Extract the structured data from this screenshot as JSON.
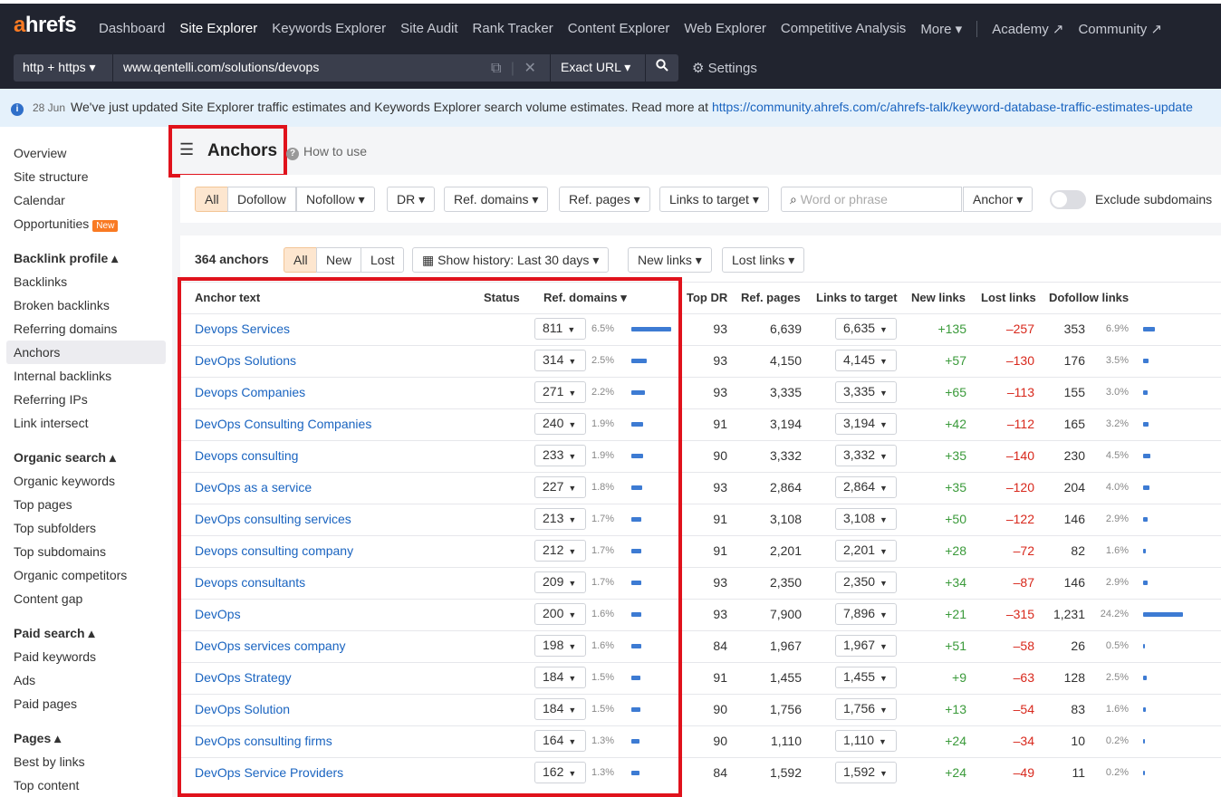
{
  "app": {
    "logo_a": "a",
    "logo_rest": "hrefs"
  },
  "nav": {
    "items": [
      "Dashboard",
      "Site Explorer",
      "Keywords Explorer",
      "Site Audit",
      "Rank Tracker",
      "Content Explorer",
      "Web Explorer",
      "Competitive Analysis",
      "More ▾"
    ],
    "active": "Site Explorer",
    "external": [
      "Academy ↗",
      "Community ↗"
    ]
  },
  "urlbar": {
    "protocol": "http + https ▾",
    "url": "www.qentelli.com/solutions/devops",
    "mode": "Exact URL ▾",
    "settings": "Settings"
  },
  "banner": {
    "date": "28 Jun",
    "text": "We've just updated Site Explorer traffic estimates and Keywords Explorer search volume estimates. Read more at ",
    "link": "https://community.ahrefs.com/c/ahrefs-talk/keyword-database-traffic-estimates-update"
  },
  "sidebar": {
    "overview": "Overview",
    "site_structure": "Site structure",
    "calendar": "Calendar",
    "opportunities": "Opportunities",
    "new_badge": "New",
    "backlink_profile": "Backlink profile ▴",
    "backlinks": "Backlinks",
    "broken_backlinks": "Broken backlinks",
    "referring_domains": "Referring domains",
    "anchors": "Anchors",
    "internal_backlinks": "Internal backlinks",
    "referring_ips": "Referring IPs",
    "link_intersect": "Link intersect",
    "organic_search": "Organic search ▴",
    "organic_keywords": "Organic keywords",
    "top_pages": "Top pages",
    "top_subfolders": "Top subfolders",
    "top_subdomains": "Top subdomains",
    "organic_competitors": "Organic competitors",
    "content_gap": "Content gap",
    "paid_search": "Paid search ▴",
    "paid_keywords": "Paid keywords",
    "ads": "Ads",
    "paid_pages": "Paid pages",
    "pages": "Pages ▴",
    "best_by_links": "Best by links",
    "top_content": "Top content"
  },
  "page": {
    "title": "Anchors",
    "how_to_use": "How to use"
  },
  "filters": {
    "all": "All",
    "dofollow": "Dofollow",
    "nofollow": "Nofollow ▾",
    "dr": "DR ▾",
    "ref_domains": "Ref. domains ▾",
    "ref_pages": "Ref. pages ▾",
    "links_to_target": "Links to target ▾",
    "search_placeholder": "Word or phrase",
    "anchor": "Anchor ▾",
    "exclude_subdomains": "Exclude subdomains"
  },
  "tablebar": {
    "count": "364 anchors",
    "all": "All",
    "new": "New",
    "lost": "Lost",
    "history": "Show history: Last 30 days ▾",
    "new_links": "New links ▾",
    "lost_links": "Lost links ▾"
  },
  "columns": {
    "anchor_text": "Anchor text",
    "status": "Status",
    "ref_domains": "Ref. domains ▾",
    "top_dr": "Top DR",
    "ref_pages": "Ref. pages",
    "links_to_target": "Links to target",
    "new_links": "New links",
    "lost_links": "Lost links",
    "dofollow_links": "Dofollow links"
  },
  "rows": [
    {
      "anchor": "Devops Services",
      "ref": "811",
      "ref_pct": "6.5%",
      "ref_frac": 1.0,
      "dr": "93",
      "pages": "6,639",
      "ltt": "6,635",
      "new": "+135",
      "lost": "–257",
      "dof": "353",
      "dof_pct": "6.9%",
      "dof_frac": 0.29
    },
    {
      "anchor": "DevOps Solutions",
      "ref": "314",
      "ref_pct": "2.5%",
      "ref_frac": 0.39,
      "dr": "93",
      "pages": "4,150",
      "ltt": "4,145",
      "new": "+57",
      "lost": "–130",
      "dof": "176",
      "dof_pct": "3.5%",
      "dof_frac": 0.14
    },
    {
      "anchor": "Devops Companies",
      "ref": "271",
      "ref_pct": "2.2%",
      "ref_frac": 0.33,
      "dr": "93",
      "pages": "3,335",
      "ltt": "3,335",
      "new": "+65",
      "lost": "–113",
      "dof": "155",
      "dof_pct": "3.0%",
      "dof_frac": 0.12
    },
    {
      "anchor": "DevOps Consulting Companies",
      "ref": "240",
      "ref_pct": "1.9%",
      "ref_frac": 0.29,
      "dr": "91",
      "pages": "3,194",
      "ltt": "3,194",
      "new": "+42",
      "lost": "–112",
      "dof": "165",
      "dof_pct": "3.2%",
      "dof_frac": 0.13
    },
    {
      "anchor": "Devops consulting",
      "ref": "233",
      "ref_pct": "1.9%",
      "ref_frac": 0.29,
      "dr": "90",
      "pages": "3,332",
      "ltt": "3,332",
      "new": "+35",
      "lost": "–140",
      "dof": "230",
      "dof_pct": "4.5%",
      "dof_frac": 0.19
    },
    {
      "anchor": "DevOps as a service",
      "ref": "227",
      "ref_pct": "1.8%",
      "ref_frac": 0.28,
      "dr": "93",
      "pages": "2,864",
      "ltt": "2,864",
      "new": "+35",
      "lost": "–120",
      "dof": "204",
      "dof_pct": "4.0%",
      "dof_frac": 0.17
    },
    {
      "anchor": "DevOps consulting services",
      "ref": "213",
      "ref_pct": "1.7%",
      "ref_frac": 0.26,
      "dr": "91",
      "pages": "3,108",
      "ltt": "3,108",
      "new": "+50",
      "lost": "–122",
      "dof": "146",
      "dof_pct": "2.9%",
      "dof_frac": 0.12
    },
    {
      "anchor": "Devops consulting company",
      "ref": "212",
      "ref_pct": "1.7%",
      "ref_frac": 0.26,
      "dr": "91",
      "pages": "2,201",
      "ltt": "2,201",
      "new": "+28",
      "lost": "–72",
      "dof": "82",
      "dof_pct": "1.6%",
      "dof_frac": 0.07
    },
    {
      "anchor": "Devops consultants",
      "ref": "209",
      "ref_pct": "1.7%",
      "ref_frac": 0.26,
      "dr": "93",
      "pages": "2,350",
      "ltt": "2,350",
      "new": "+34",
      "lost": "–87",
      "dof": "146",
      "dof_pct": "2.9%",
      "dof_frac": 0.12
    },
    {
      "anchor": "DevOps",
      "ref": "200",
      "ref_pct": "1.6%",
      "ref_frac": 0.25,
      "dr": "93",
      "pages": "7,900",
      "ltt": "7,896",
      "new": "+21",
      "lost": "–315",
      "dof": "1,231",
      "dof_pct": "24.2%",
      "dof_frac": 1.0
    },
    {
      "anchor": "DevOps services company",
      "ref": "198",
      "ref_pct": "1.6%",
      "ref_frac": 0.25,
      "dr": "84",
      "pages": "1,967",
      "ltt": "1,967",
      "new": "+51",
      "lost": "–58",
      "dof": "26",
      "dof_pct": "0.5%",
      "dof_frac": 0.02
    },
    {
      "anchor": "DevOps Strategy",
      "ref": "184",
      "ref_pct": "1.5%",
      "ref_frac": 0.23,
      "dr": "91",
      "pages": "1,455",
      "ltt": "1,455",
      "new": "+9",
      "lost": "–63",
      "dof": "128",
      "dof_pct": "2.5%",
      "dof_frac": 0.1
    },
    {
      "anchor": "DevOps Solution",
      "ref": "184",
      "ref_pct": "1.5%",
      "ref_frac": 0.23,
      "dr": "90",
      "pages": "1,756",
      "ltt": "1,756",
      "new": "+13",
      "lost": "–54",
      "dof": "83",
      "dof_pct": "1.6%",
      "dof_frac": 0.07
    },
    {
      "anchor": "DevOps consulting firms",
      "ref": "164",
      "ref_pct": "1.3%",
      "ref_frac": 0.2,
      "dr": "90",
      "pages": "1,110",
      "ltt": "1,110",
      "new": "+24",
      "lost": "–34",
      "dof": "10",
      "dof_pct": "0.2%",
      "dof_frac": 0.01
    },
    {
      "anchor": "DevOps Service Providers",
      "ref": "162",
      "ref_pct": "1.3%",
      "ref_frac": 0.2,
      "dr": "84",
      "pages": "1,592",
      "ltt": "1,592",
      "new": "+24",
      "lost": "–49",
      "dof": "11",
      "dof_pct": "0.2%",
      "dof_frac": 0.01
    }
  ],
  "colors": {
    "accent": "#f97a23",
    "link": "#1a64c0",
    "highlight": "#e0121c",
    "positive": "#3a9a3a",
    "negative": "#d8281c",
    "bar": "#3d7bd3"
  }
}
